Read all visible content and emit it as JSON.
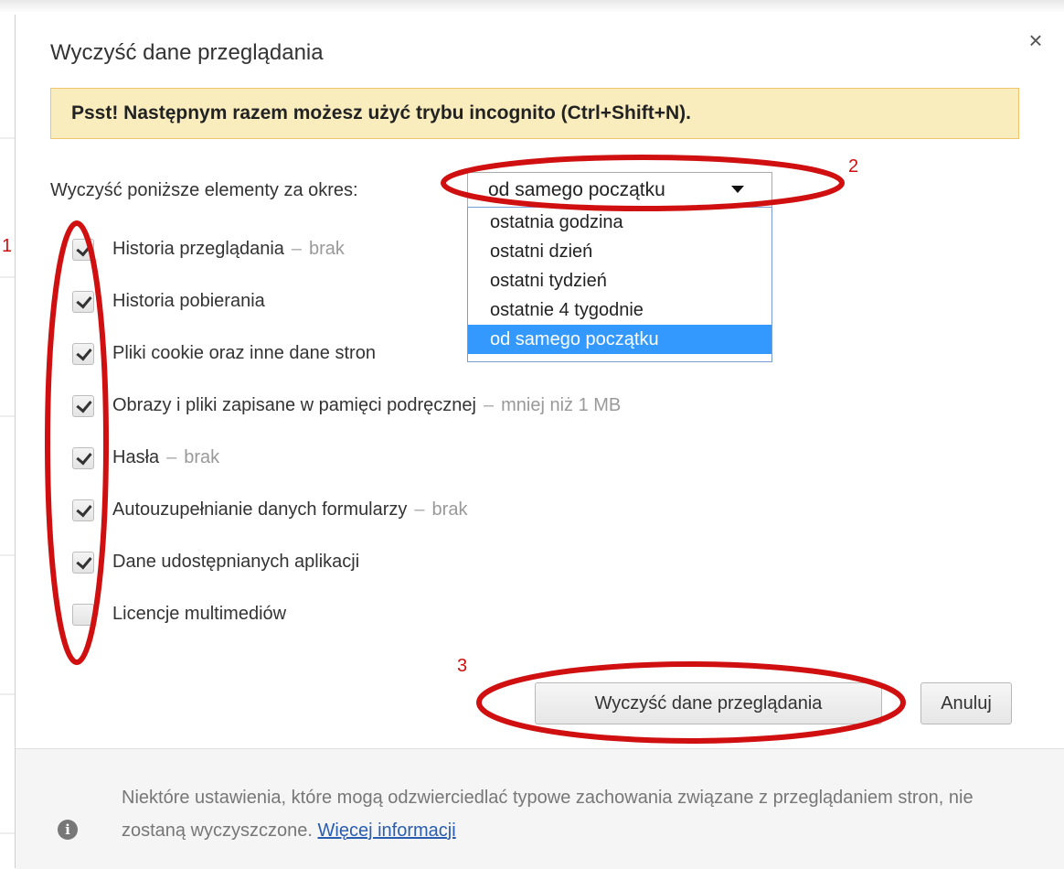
{
  "dialog": {
    "title": "Wyczyść dane przeglądania",
    "close_glyph": "×",
    "banner": "Psst! Następnym razem możesz użyć trybu incognito (Ctrl+Shift+N).",
    "period_label": "Wyczyść poniższe elementy za okres:",
    "period_selected": "od samego początku",
    "period_options": [
      "ostatnia godzina",
      "ostatni dzień",
      "ostatni tydzień",
      "ostatnie 4 tygodnie",
      "od samego początku"
    ],
    "items": [
      {
        "label": "Historia przeglądania",
        "value": "brak",
        "checked": true
      },
      {
        "label": "Historia pobierania",
        "value": "",
        "checked": true
      },
      {
        "label": "Pliki cookie oraz inne dane stron",
        "value": "",
        "checked": true
      },
      {
        "label": "Obrazy i pliki zapisane w pamięci podręcznej",
        "value": "mniej niż 1 MB",
        "checked": true
      },
      {
        "label": "Hasła",
        "value": "brak",
        "checked": true
      },
      {
        "label": "Autouzupełnianie danych formularzy",
        "value": "brak",
        "checked": true
      },
      {
        "label": "Dane udostępnianych aplikacji",
        "value": "",
        "checked": true
      },
      {
        "label": "Licencje multimediów",
        "value": "",
        "checked": false
      }
    ],
    "dash": "–",
    "clear_button": "Wyczyść dane przeglądania",
    "cancel_button": "Anuluj",
    "footer_text": "Niektóre ustawienia, które mogą odzwierciedlać typowe zachowania związane z przeglądaniem stron, nie zostaną wyczyszczone.",
    "footer_link": "Więcej informacji"
  },
  "annotations": {
    "one": "1",
    "two": "2",
    "three": "3",
    "color": "#d01010"
  }
}
